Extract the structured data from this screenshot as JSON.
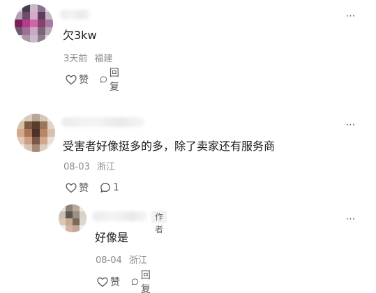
{
  "icons": {
    "more": "more-options-icon",
    "like": "heart-icon",
    "reply": "comment-icon"
  },
  "comments": [
    {
      "text": "欠3kw",
      "time": "3天前",
      "location": "福建",
      "like_label": "赞",
      "reply_label": "回复",
      "more": "⋯"
    },
    {
      "text": "受害者好像挺多的多，除了卖家还有服务商",
      "time": "08-03",
      "location": "浙江",
      "like_label": "赞",
      "reply_label": "1",
      "more": "⋯"
    },
    {
      "text": "好像是",
      "time": "08-04",
      "location": "浙江",
      "like_label": "赞",
      "reply_label": "回复",
      "more": "⋯",
      "author_tag": "作者"
    }
  ]
}
